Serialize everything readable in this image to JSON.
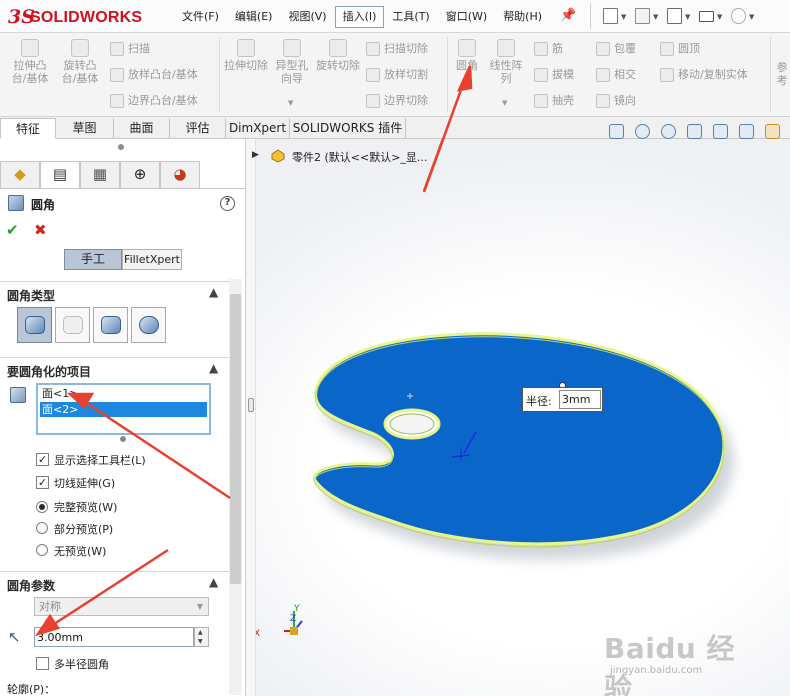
{
  "app": {
    "brand_ds": "3S",
    "brand_name": "SOLIDWORKS"
  },
  "menu": [
    {
      "label": "文件(F)",
      "active": false
    },
    {
      "label": "编辑(E)",
      "active": false
    },
    {
      "label": "视图(V)",
      "active": false
    },
    {
      "label": "插入(I)",
      "active": true
    },
    {
      "label": "工具(T)",
      "active": false
    },
    {
      "label": "窗口(W)",
      "active": false
    },
    {
      "label": "帮助(H)",
      "active": false
    }
  ],
  "ribbon": {
    "extrude_boss": "拉伸凸台/基体",
    "revolve_boss": "旋转凸台/基体",
    "sweep": "扫描",
    "loft_boss": "放样凸台/基体",
    "boundary_boss": "边界凸台/基体",
    "extrude_cut": "拉伸切除",
    "hole_wizard": "异型孔向导",
    "revolve_cut": "旋转切除",
    "swept_cut": "扫描切除",
    "lofted_cut": "放样切割",
    "boundary_cut": "边界切除",
    "fillet": "圆角",
    "linear_pattern": "线性阵列",
    "rib": "筋",
    "draft": "拔模",
    "shell": "抽壳",
    "wrap": "包覆",
    "intersect": "相交",
    "mirror": "镜向",
    "dome": "圆顶",
    "move_copy": "移动/复制实体",
    "more": "参考"
  },
  "tabs": [
    "特征",
    "草图",
    "曲面",
    "评估",
    "DimXpert",
    "SOLIDWORKS 插件"
  ],
  "pm": {
    "title": "圆角",
    "help": "?",
    "mode_manual": "手工",
    "mode_xpert": "FilletXpert",
    "fillet_type_header": "圆角类型",
    "items_header": "要圆角化的项目",
    "items": [
      "面<1>",
      "面<2>"
    ],
    "options": {
      "show_toolbar": "显示选择工具栏(L)",
      "tangent": "切线延伸(G)",
      "preview_full": "完整预览(W)",
      "preview_partial": "部分预览(P)",
      "preview_none": "无预览(W)"
    },
    "params_header": "圆角参数",
    "symmetric": "对称",
    "radius_value": "3.00mm",
    "multi_radius": "多半径圆角",
    "profile_label": "轮廓(P)："
  },
  "tree": {
    "part": "零件2  (默认<<默认>_显..."
  },
  "callout": {
    "label": "半径:",
    "value": "3mm"
  },
  "triad": {
    "x": "X",
    "y": "Y",
    "z": "Z"
  },
  "watermark": {
    "main": "Baidu 经验",
    "sub": "jingyan.baidu.com"
  },
  "colors": {
    "model_blue": "#0a66c8",
    "edge_yellow": "#e7f58a",
    "arrow_red": "#e8412f",
    "brand_red": "#d1101f"
  }
}
